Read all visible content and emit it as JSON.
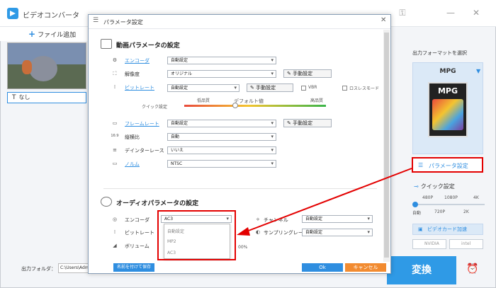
{
  "app": {
    "title": "ビデオコンバータ",
    "add_file": "ファイル追加",
    "subtitle_value": "なし",
    "output_folder_label": "出力フォルダ：",
    "output_folder_value": "C:\\Users\\Adm",
    "convert_label": "変換",
    "convert_icon": "alarm-clock-icon"
  },
  "right_panel": {
    "output_format_label": "出力フォーマットを選択",
    "format_name": "MPG",
    "format_icon_label": "MPG",
    "param_button": "パラメータ設定",
    "quick_label": "クイック設定",
    "quick_top": [
      "480P",
      "1080P",
      "4K"
    ],
    "quick_bottom": [
      "自動",
      "720P",
      "2K"
    ],
    "quick_level": 0,
    "gpu_label": "ビデオカード加速",
    "gpu_vendors": [
      "NVIDIA",
      "intel"
    ]
  },
  "dialog": {
    "title": "パラメータ設定",
    "video_section": "動画パラメータの設定",
    "video_rows": [
      {
        "label": "エンコーダ",
        "value": "自動設定",
        "link": true
      },
      {
        "label": "解像度",
        "value": "オリジナル",
        "link": false,
        "button": "手動設定"
      },
      {
        "label": "ビットレート",
        "value": "自動設定",
        "link": true,
        "button": "手動設定"
      },
      {
        "label": "フレームレート",
        "value": "自動設定",
        "link": true,
        "button": "手動設定"
      },
      {
        "label": "縦横比",
        "value": "自動",
        "link": false
      },
      {
        "label": "デインターレース",
        "value": "いいえ",
        "link": false
      },
      {
        "label": "ノルム",
        "value": "NTSC",
        "link": true
      }
    ],
    "aspect_icon": "16:9",
    "vbr_label": "VBR",
    "lossless_label": "ロスレスモード",
    "quick_setting_label": "クイック設定",
    "quality_low": "低品質",
    "quality_default": "デフォルト値",
    "quality_high": "高品質",
    "quality_level": 0.37,
    "audio_section": "オーディオパラメータの設定",
    "audio_rows_left": [
      {
        "label": "エンコーダ",
        "value": "AC3"
      },
      {
        "label": "ビットレート"
      },
      {
        "label": "ボリューム"
      }
    ],
    "audio_rows_right": [
      {
        "label": "チャンネル",
        "value": "自動設定"
      },
      {
        "label": "サンプリングレート",
        "value": "自動設定"
      }
    ],
    "volume_value": "00%",
    "dropdown_options": [
      "自動設定",
      "MP2",
      "AC3"
    ],
    "save_button": "名前を付けて保存",
    "ok_button": "Ok",
    "cancel_button": "キャンセル",
    "annotation_color": "#e30000"
  }
}
